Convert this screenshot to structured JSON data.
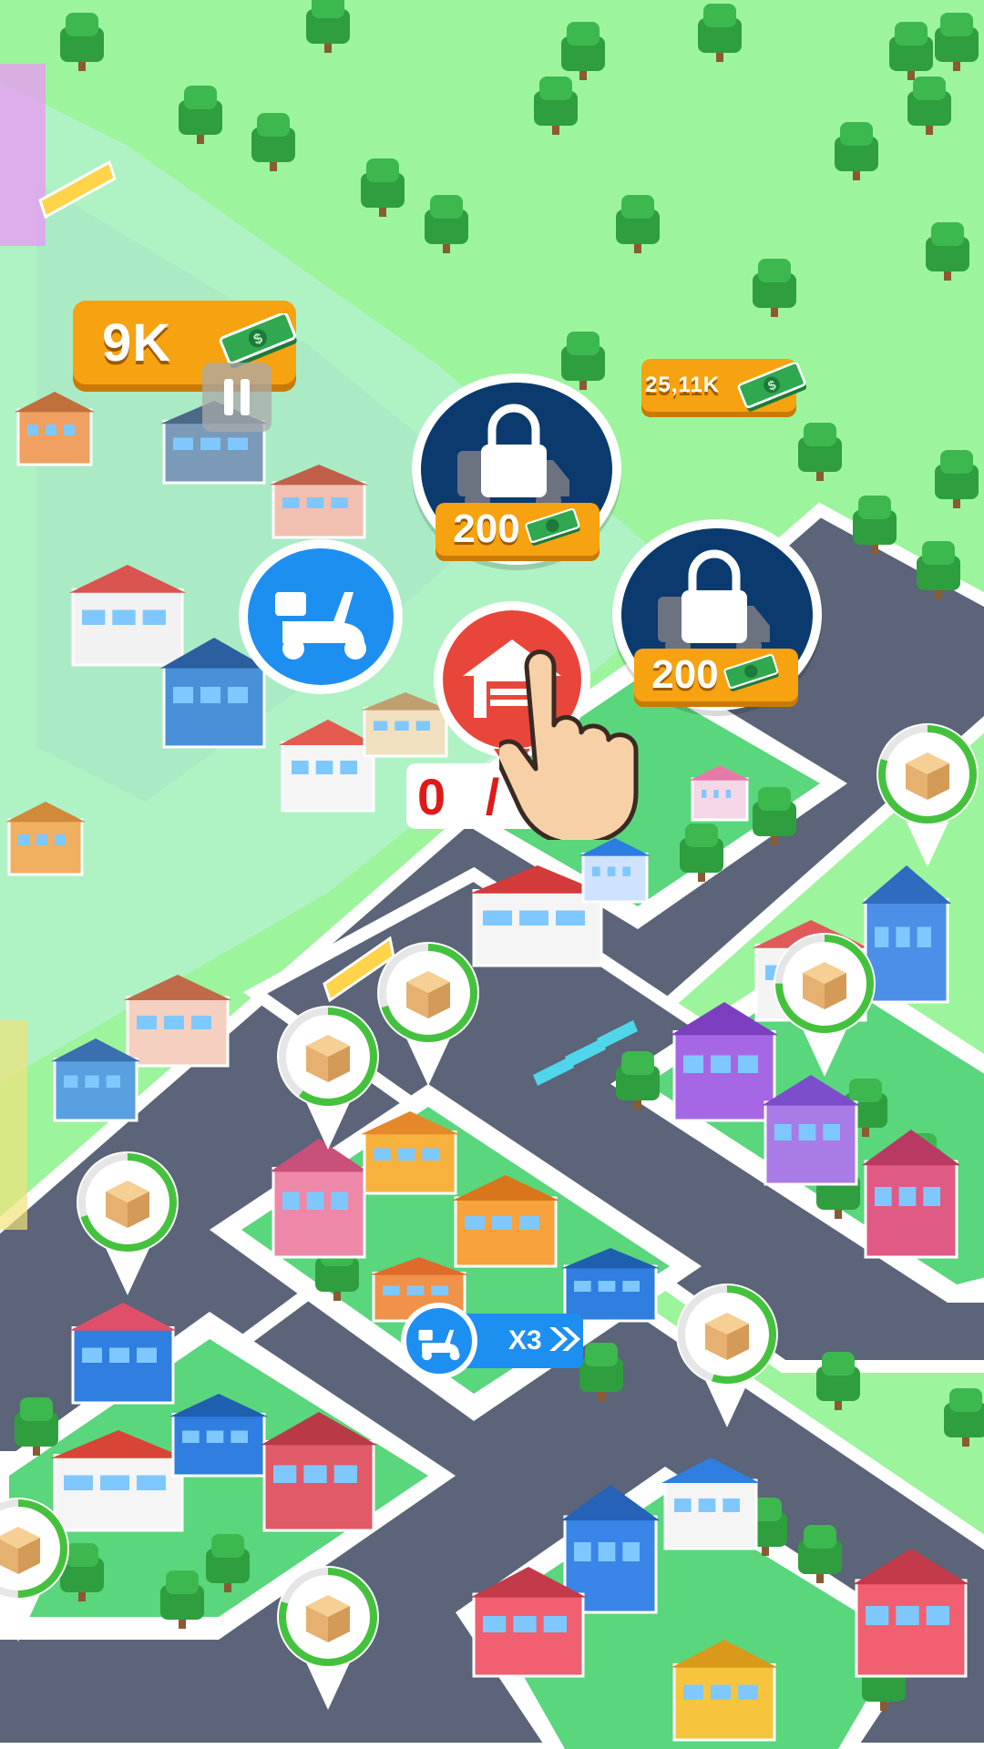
{
  "hud": {
    "money_label": "9K",
    "pause_icon": "pause-icon",
    "cash_icon": "cash-stack-icon"
  },
  "earnings": {
    "label": "25,11K"
  },
  "unlocks": [
    {
      "price": "200",
      "icon": "locked-truck-icon"
    },
    {
      "price": "200",
      "icon": "locked-truck-icon"
    }
  ],
  "actions": {
    "scooter_icon": "scooter-icon",
    "garage_icon": "garage-icon",
    "garage_counter": "0 /",
    "boost_label": "X3",
    "boost_icon": "fast-forward-icon"
  },
  "colors": {
    "grass": "#9cf59c",
    "road": "#5b6478",
    "badge": "#f7a211",
    "lock_bubble": "#0b3a6e",
    "scooter_bubble": "#1d8ff0",
    "garage_bubble": "#e8463a"
  }
}
